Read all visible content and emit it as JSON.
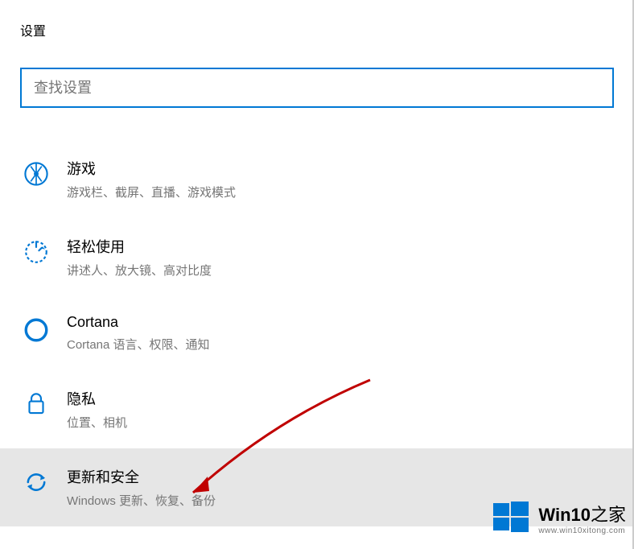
{
  "header": {
    "title": "设置"
  },
  "search": {
    "placeholder": "查找设置",
    "value": ""
  },
  "items": [
    {
      "icon": "gaming",
      "title": "游戏",
      "desc": "游戏栏、截屏、直播、游戏模式"
    },
    {
      "icon": "ease-of-access",
      "title": "轻松使用",
      "desc": "讲述人、放大镜、高对比度"
    },
    {
      "icon": "cortana",
      "title": "Cortana",
      "desc": "Cortana 语言、权限、通知"
    },
    {
      "icon": "privacy",
      "title": "隐私",
      "desc": "位置、相机"
    },
    {
      "icon": "update",
      "title": "更新和安全",
      "desc": "Windows 更新、恢复、备份"
    }
  ],
  "watermark": {
    "title_main": "Win10",
    "title_suffix": "之家",
    "url": "www.win10xitong.com"
  },
  "colors": {
    "accent": "#0078d4",
    "text_secondary": "#767676",
    "highlight_bg": "#e6e6e6",
    "arrow": "#c00000"
  }
}
